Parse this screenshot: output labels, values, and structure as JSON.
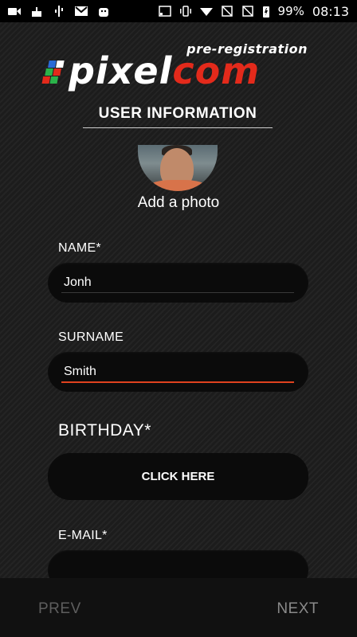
{
  "status_bar": {
    "battery": "99%",
    "time": "08:13",
    "left_icons": [
      "video-icon",
      "cake-icon",
      "usb-icon",
      "gmail-icon",
      "android-icon"
    ],
    "right_icons": [
      "cast-icon",
      "vibrate-icon",
      "wifi-icon",
      "no-sim-icon",
      "no-sim-icon",
      "battery-charging-icon"
    ]
  },
  "logo": {
    "pre": "pre-registration",
    "word_a": "pixel",
    "word_b": "com",
    "square_colors": [
      "#2a6bd6",
      "#2bb34a",
      "#e32a1b",
      "#ffffff"
    ]
  },
  "section_title": "USER INFORMATION",
  "photo": {
    "label": "Add a photo"
  },
  "form": {
    "name_label": "NAME*",
    "name_value": "Jonh",
    "surname_label": "SURNAME",
    "surname_value": "Smith",
    "birthday_label": "BIRTHDAY*",
    "birthday_button": "CLICK HERE",
    "email_label": "E-MAIL*",
    "email_value": ""
  },
  "nav": {
    "prev": "PREV",
    "next": "NEXT"
  },
  "colors": {
    "accent": "#e0421f",
    "brand_red": "#e32a1b",
    "background": "#1c1c1c"
  }
}
